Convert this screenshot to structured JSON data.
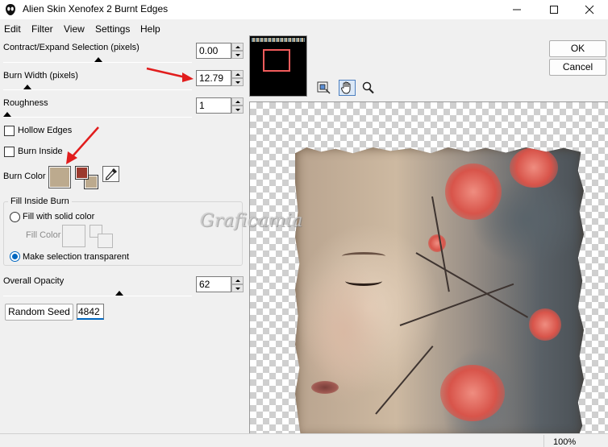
{
  "window": {
    "title": "Alien Skin Xenofex 2 Burnt Edges",
    "minimize_icon": "minimize-icon",
    "maximize_icon": "maximize-icon",
    "close_icon": "close-icon"
  },
  "menu": [
    "Edit",
    "Filter",
    "View",
    "Settings",
    "Help"
  ],
  "controls": {
    "contract_expand": {
      "label": "Contract/Expand Selection (pixels)",
      "value": "0.00",
      "slider_fraction": 0.5
    },
    "burn_width": {
      "label": "Burn Width (pixels)",
      "value": "12.79",
      "slider_fraction": 0.12
    },
    "roughness": {
      "label": "Roughness",
      "value": "1",
      "slider_fraction": 0.0
    },
    "hollow_edges": {
      "label": "Hollow Edges",
      "checked": false
    },
    "burn_inside": {
      "label": "Burn Inside",
      "checked": false
    },
    "burn_color": {
      "label": "Burn Color",
      "color": "#bcaa8e",
      "fg_color": "#9b3a2e",
      "bg_color": "#bcaa8e",
      "eyedropper_icon": "eyedropper-icon"
    },
    "fill_inside_burn": {
      "title": "Fill Inside Burn",
      "fill_solid": {
        "label": "Fill with solid color",
        "checked": false
      },
      "fill_color_label": "Fill Color",
      "transparent": {
        "label": "Make selection transparent",
        "checked": true
      }
    },
    "overall_opacity": {
      "label": "Overall Opacity",
      "value": "62",
      "slider_fraction": 0.55
    },
    "random_seed": {
      "button_label": "Random Seed",
      "value": "4842"
    }
  },
  "buttons": {
    "ok": "OK",
    "cancel": "Cancel"
  },
  "tools": [
    "navigator-icon",
    "hand-icon",
    "zoom-icon"
  ],
  "watermark": "Graficamia",
  "status": {
    "zoom": "100%"
  },
  "colors": {
    "accent": "#0067c0",
    "annotation_arrow": "#e11d1d"
  }
}
